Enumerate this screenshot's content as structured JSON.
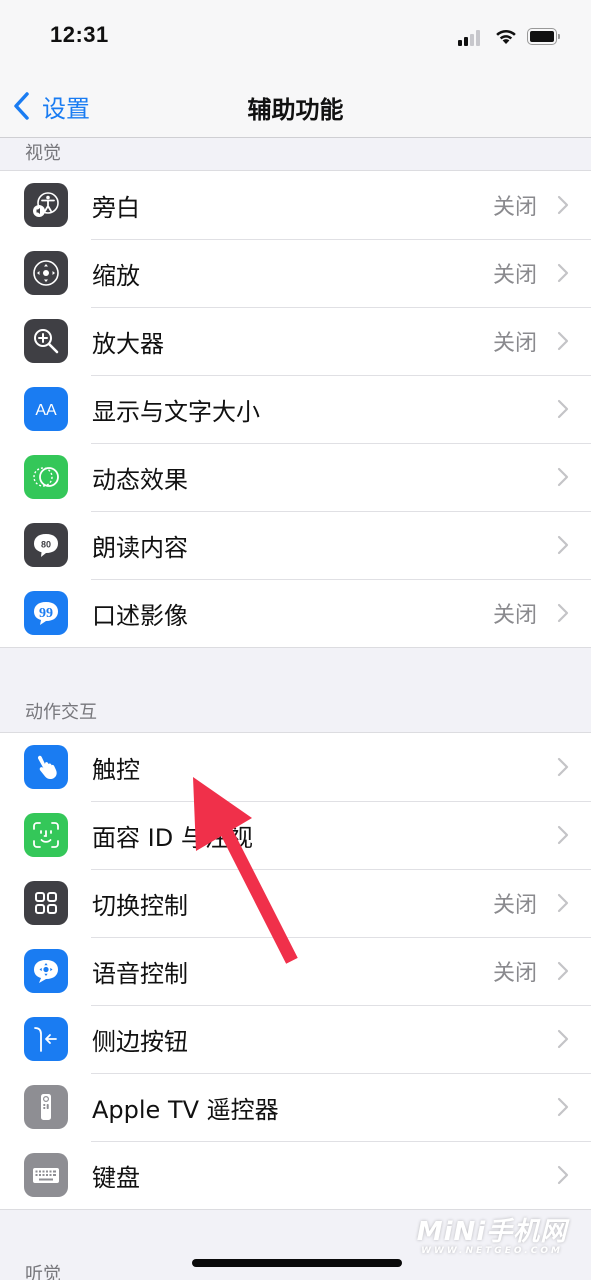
{
  "status_bar": {
    "time": "12:31",
    "signal_icon": "cellular-signal-icon",
    "wifi_icon": "wifi-icon",
    "battery_icon": "battery-icon"
  },
  "nav": {
    "back_label": "设置",
    "title": "辅助功能"
  },
  "colors": {
    "accent": "#1a7cf2",
    "icon_blue": "#1a7cf2",
    "icon_green": "#34c759",
    "icon_dark": "#3f3f44",
    "icon_gray": "#8e8e93",
    "annotation_arrow": "#f0304a"
  },
  "sections": [
    {
      "header": "视觉",
      "items": [
        {
          "label": "旁白",
          "value": "关闭",
          "icon": "voiceover-icon"
        },
        {
          "label": "缩放",
          "value": "关闭",
          "icon": "zoom-icon"
        },
        {
          "label": "放大器",
          "value": "关闭",
          "icon": "magnifier-icon"
        },
        {
          "label": "显示与文字大小",
          "value": "",
          "icon": "text-size-icon"
        },
        {
          "label": "动态效果",
          "value": "",
          "icon": "motion-icon"
        },
        {
          "label": "朗读内容",
          "value": "",
          "icon": "spoken-content-icon"
        },
        {
          "label": "口述影像",
          "value": "关闭",
          "icon": "audio-descriptions-icon"
        }
      ]
    },
    {
      "header": "动作交互",
      "items": [
        {
          "label": "触控",
          "value": "",
          "icon": "touch-icon"
        },
        {
          "label": "面容 ID 与注视",
          "value": "",
          "icon": "face-id-icon"
        },
        {
          "label": "切换控制",
          "value": "关闭",
          "icon": "switch-control-icon"
        },
        {
          "label": "语音控制",
          "value": "关闭",
          "icon": "voice-control-icon"
        },
        {
          "label": "侧边按钮",
          "value": "",
          "icon": "side-button-icon"
        },
        {
          "label": "Apple TV 遥控器",
          "value": "",
          "icon": "apple-tv-remote-icon"
        },
        {
          "label": "键盘",
          "value": "",
          "icon": "keyboard-icon"
        }
      ]
    },
    {
      "header": "听觉",
      "items": []
    }
  ],
  "watermark": {
    "brand": "MiNi手机网",
    "url": "WWW.NETGEO.COM"
  },
  "annotation": {
    "type": "arrow",
    "target": "触控"
  }
}
